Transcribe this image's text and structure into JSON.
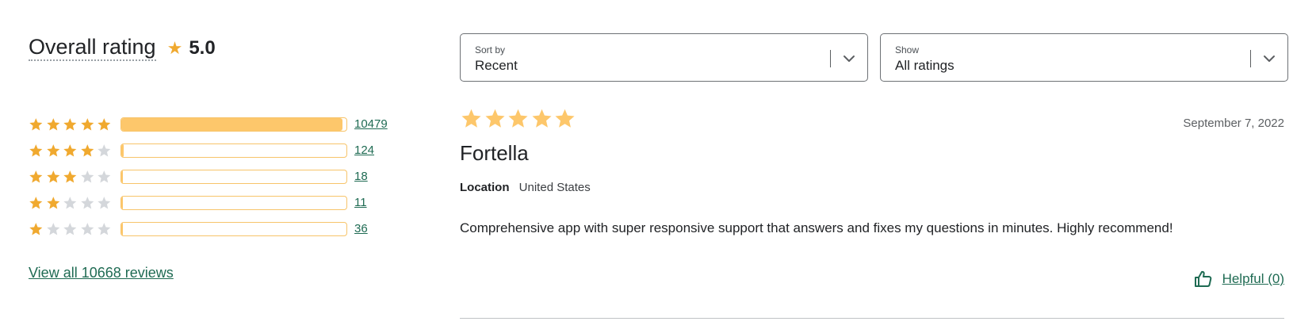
{
  "overall": {
    "label": "Overall rating",
    "star_icon": "star-icon",
    "value": "5.0"
  },
  "distribution": [
    {
      "stars": 5,
      "count": "10479",
      "fraction": 0.982
    },
    {
      "stars": 4,
      "count": "124",
      "fraction": 0.012
    },
    {
      "stars": 3,
      "count": "18",
      "fraction": 0.002
    },
    {
      "stars": 2,
      "count": "11",
      "fraction": 0.001
    },
    {
      "stars": 1,
      "count": "36",
      "fraction": 0.003
    }
  ],
  "view_all": "View all 10668 reviews",
  "sort": {
    "label": "Sort by",
    "value": "Recent"
  },
  "show": {
    "label": "Show",
    "value": "All ratings"
  },
  "review": {
    "rating": 5,
    "date": "September 7, 2022",
    "reviewer": "Fortella",
    "location_label": "Location",
    "location_value": "United States",
    "body": "Comprehensive app with super responsive support that answers and fixes my questions in minutes. Highly recommend!",
    "helpful": "Helpful (0)"
  },
  "colors": {
    "star_filled": "#f0a92f",
    "star_empty": "#d4d7db",
    "review_star": "#fdc76b",
    "bar_fill": "#fdc76b",
    "link": "#1f6b53"
  },
  "icons": [
    "star-icon",
    "chevron-down-icon",
    "thumbs-up-icon"
  ]
}
